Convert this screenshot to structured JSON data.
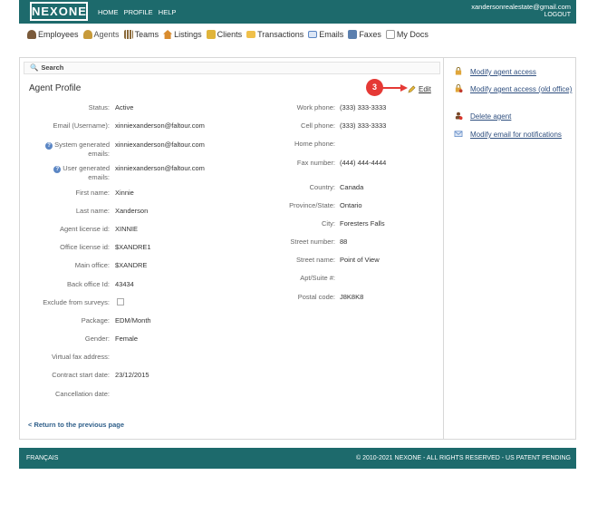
{
  "header": {
    "logo": "NEXONE",
    "nav": [
      "HOME",
      "PROFILE",
      "HELP"
    ],
    "user_email": "xandersonrealestate@gmail.com",
    "logout": "LOGOUT",
    "bg_color": "#1d6a6c"
  },
  "main_nav": [
    {
      "label": "Employees",
      "icon": "people-icon"
    },
    {
      "label": "Agents",
      "icon": "agent-icon"
    },
    {
      "label": "Teams",
      "icon": "teams-icon"
    },
    {
      "label": "Listings",
      "icon": "house-icon"
    },
    {
      "label": "Clients",
      "icon": "clients-icon"
    },
    {
      "label": "Transactions",
      "icon": "folder-icon"
    },
    {
      "label": "Emails",
      "icon": "envelope-icon"
    },
    {
      "label": "Faxes",
      "icon": "fax-icon"
    },
    {
      "label": "My Docs",
      "icon": "docs-icon"
    }
  ],
  "search": {
    "label": "Search"
  },
  "profile": {
    "title": "Agent Profile",
    "edit_label": "Edit",
    "step_badge": "3",
    "left_fields": [
      {
        "label": "Status:",
        "value": "Active"
      },
      {
        "label": "Email (Username):",
        "value": "xinniexanderson@faltour.com"
      },
      {
        "label": "System generated emails:",
        "value": "xinniexanderson@faltour.com"
      },
      {
        "label": "User generated emails:",
        "value": "xinniexanderson@faltour.com"
      },
      {
        "label": "First name:",
        "value": "Xinnie"
      },
      {
        "label": "Last name:",
        "value": "Xanderson"
      },
      {
        "label": "Agent license id:",
        "value": "XINNIE"
      },
      {
        "label": "Office license id:",
        "value": "$XANDRE1"
      },
      {
        "label": "Main office:",
        "value": "$XANDRE"
      },
      {
        "label": "Back office Id:",
        "value": "43434"
      },
      {
        "label": "Exclude from surveys:",
        "value": ""
      },
      {
        "label": "Package:",
        "value": "EDM/Month"
      },
      {
        "label": "Gender:",
        "value": "Female"
      },
      {
        "label": "Virtual fax address:",
        "value": ""
      },
      {
        "label": "Contract start date:",
        "value": "23/12/2015"
      },
      {
        "label": "Cancellation date:",
        "value": ""
      }
    ],
    "right_fields": [
      {
        "label": "Work phone:",
        "value": "(333) 333-3333"
      },
      {
        "label": "Cell phone:",
        "value": "(333) 333-3333"
      },
      {
        "label": "Home phone:",
        "value": ""
      },
      {
        "label": "Fax number:",
        "value": "(444) 444-4444"
      },
      {
        "label": "Country:",
        "value": "Canada"
      },
      {
        "label": "Province/State:",
        "value": "Ontario"
      },
      {
        "label": "City:",
        "value": "Foresters Falls"
      },
      {
        "label": "Street number:",
        "value": "88"
      },
      {
        "label": "Street name:",
        "value": "Point of View"
      },
      {
        "label": "Apt/Suite #:",
        "value": ""
      },
      {
        "label": "Postal code:",
        "value": "J8K8K8"
      }
    ],
    "back_link": "< Return to the previous page"
  },
  "actions": [
    {
      "label": "Modify agent access",
      "icon": "lock-icon"
    },
    {
      "label": "Modify agent access (old office)",
      "icon": "lock-edit-icon"
    },
    {
      "label": "Delete agent",
      "icon": "delete-user-icon"
    },
    {
      "label": "Modify email for notifications",
      "icon": "envelope-icon"
    }
  ],
  "footer": {
    "language": "FRANÇAIS",
    "copyright": "© 2010-2021 NEXONE - ALL RIGHTS RESERVED - US PATENT PENDING"
  }
}
